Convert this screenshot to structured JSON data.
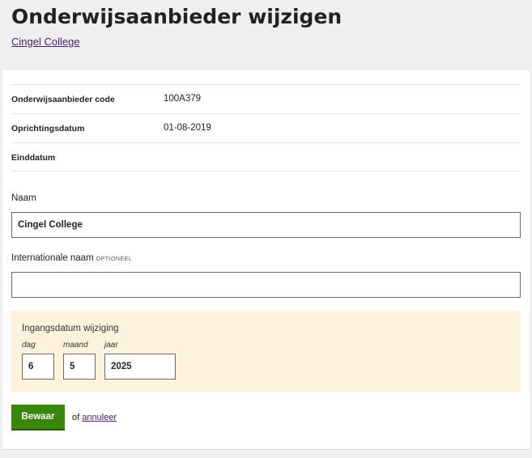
{
  "page": {
    "title": "Onderwijsaanbieder wijzigen",
    "breadcrumb_link": "Cingel College"
  },
  "info": {
    "rows": [
      {
        "label": "Onderwijsaanbieder code",
        "value": "100A379"
      },
      {
        "label": "Oprichtingsdatum",
        "value": "01-08-2019"
      },
      {
        "label": "Einddatum",
        "value": ""
      }
    ]
  },
  "form": {
    "naam": {
      "label": "Naam",
      "value": "Cingel College"
    },
    "internationale_naam": {
      "label": "Internationale naam",
      "optional_tag": "OPTIONEEL",
      "value": ""
    },
    "ingangsdatum": {
      "legend": "Ingangsdatum wijziging",
      "dag": {
        "label": "dag",
        "value": "6"
      },
      "maand": {
        "label": "maand",
        "value": "5"
      },
      "jaar": {
        "label": "jaar",
        "value": "2025"
      }
    },
    "save_label": "Bewaar",
    "cancel_prefix": "of",
    "cancel_link": "annuleer"
  },
  "colors": {
    "primary_button": "#39870c",
    "link": "#4b1d6e",
    "date_panel_bg": "#fdf2dc"
  }
}
